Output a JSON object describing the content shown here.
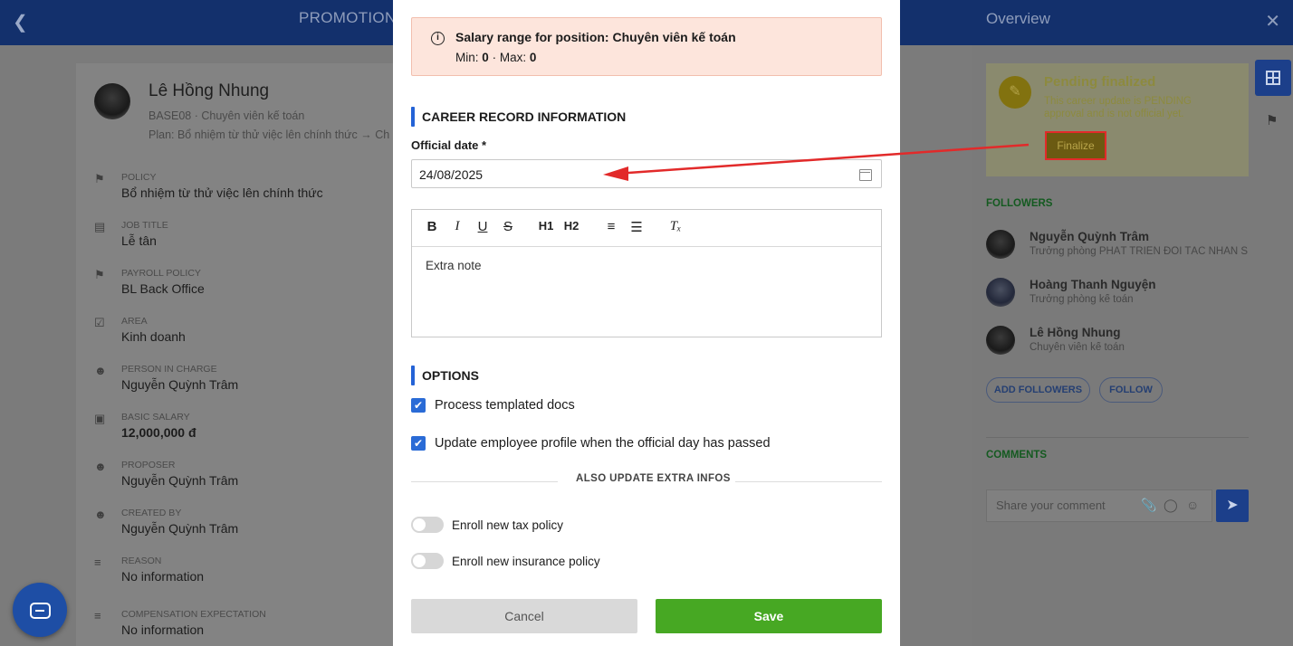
{
  "header": {
    "back_icon": "arrow-left-icon",
    "title": "PROMOTION"
  },
  "employee": {
    "name": "Lê Hồng Nhung",
    "code_position": "BASE08 · Chuyên viên kế toán",
    "plan": "Plan: Bổ nhiệm từ thử việc lên chính thức → Ch"
  },
  "fields": [
    {
      "label": "POLICY",
      "value": "Bổ nhiệm từ thử việc lên chính thức",
      "icon": "flag-icon"
    },
    {
      "label": "JOB TITLE",
      "value": "Lễ tân",
      "icon": "briefcase-icon"
    },
    {
      "label": "PAYROLL POLICY",
      "value": "BL Back Office",
      "icon": "flag-icon"
    },
    {
      "label": "AREA",
      "value": "Kinh doanh",
      "icon": "checkbox-icon"
    },
    {
      "label": "PERSON IN CHARGE",
      "value": "Nguyễn Quỳnh Trâm",
      "icon": "user-check-icon"
    },
    {
      "label": "BASIC SALARY",
      "value": "12,000,000 đ",
      "icon": "money-icon"
    },
    {
      "label": "PROPOSER",
      "value": "Nguyễn Quỳnh Trâm",
      "icon": "user-check-icon"
    },
    {
      "label": "CREATED BY",
      "value": "Nguyễn Quỳnh Trâm",
      "icon": "user-check-icon"
    },
    {
      "label": "REASON",
      "value": "No information",
      "icon": "lines-icon"
    },
    {
      "label": "COMPENSATION EXPECTATION",
      "value": "No information",
      "icon": "lines-icon"
    }
  ],
  "modal": {
    "alert": {
      "title": "Salary range for position: Chuyên viên kế toán",
      "min_label": "Min:",
      "min": "0",
      "sep": "·",
      "max_label": "Max:",
      "max": "0"
    },
    "career_section": "CAREER RECORD INFORMATION",
    "official_date_label": "Official date *",
    "official_date_value": "24/08/2025",
    "toolbar": [
      "B",
      "I",
      "U",
      "S",
      "H1",
      "H2",
      "ordered-list",
      "bullet-list",
      "clear-format"
    ],
    "note_placeholder": "Extra note",
    "options_section": "OPTIONS",
    "option1": "Process templated docs",
    "option2": "Update employee profile when the official day has passed",
    "also_update": "ALSO UPDATE EXTRA INFOS",
    "toggle1": "Enroll new tax policy",
    "toggle2": "Enroll new insurance policy",
    "cancel": "Cancel",
    "save": "Save"
  },
  "right": {
    "title": "Overview",
    "pending_title": "Pending finalized",
    "pending_desc": "This career update is PENDING approval and is not official yet.",
    "finalize": "Finalize",
    "followers_label": "FOLLOWERS",
    "followers": [
      {
        "name": "Nguyễn Quỳnh Trâm",
        "role": "Trưởng phòng PHÁT TRIỂN ĐỐI TÁC NHÂN S..."
      },
      {
        "name": "Hoàng Thanh Nguyện",
        "role": "Trưởng phòng kế toán"
      },
      {
        "name": "Lê Hồng Nhung",
        "role": "Chuyên viên kế toán"
      }
    ],
    "add_followers": "ADD FOLLOWERS",
    "follow": "FOLLOW",
    "comments_label": "COMMENTS",
    "comment_placeholder": "Share your comment"
  },
  "colors": {
    "primary": "#2463d6",
    "save": "#47a823",
    "alert_bg": "#fde5dc",
    "arrow": "#e22a2a"
  }
}
